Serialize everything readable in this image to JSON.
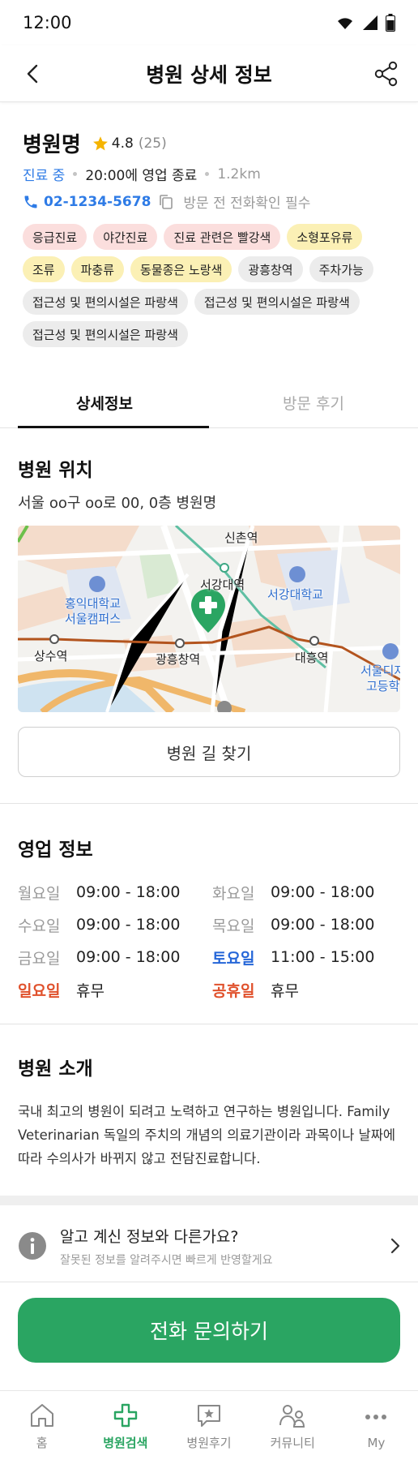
{
  "status_bar": {
    "time": "12:00"
  },
  "header": {
    "title": "병원 상세 정보"
  },
  "hospital": {
    "name": "병원명",
    "rating": "4.8",
    "review_count": "(25)",
    "open_status": "진료 중",
    "close_time": "20:00에 영업 종료",
    "distance": "1.2km",
    "phone": "02-1234-5678",
    "phone_note": "방문 전 전화확인 필수"
  },
  "tags": [
    {
      "label": "응급진료",
      "color": "red"
    },
    {
      "label": "야간진료",
      "color": "red"
    },
    {
      "label": "진료 관련은 빨강색",
      "color": "red"
    },
    {
      "label": "소형포유류",
      "color": "yellow"
    },
    {
      "label": "조류",
      "color": "yellow"
    },
    {
      "label": "파충류",
      "color": "yellow"
    },
    {
      "label": "동물종은 노랑색",
      "color": "yellow"
    },
    {
      "label": "광흥창역",
      "color": "gray"
    },
    {
      "label": "주차가능",
      "color": "gray"
    },
    {
      "label": "접근성 및 편의시설은 파랑색",
      "color": "gray"
    },
    {
      "label": "접근성 및 편의시설은 파랑색",
      "color": "gray"
    },
    {
      "label": "접근성 및 편의시설은 파랑색",
      "color": "gray"
    }
  ],
  "tabs": [
    {
      "label": "상세정보",
      "active": true
    },
    {
      "label": "방문 후기",
      "active": false
    }
  ],
  "location": {
    "title": "병원 위치",
    "address": "서울 oo구 oo로 00, 0층 병원명",
    "map_labels": {
      "sinchon": "신촌역",
      "seogang_station": "서강대역",
      "seogang_univ": "서강대학교",
      "hongik_1": "홍익대학교",
      "hongik_2": "서울캠퍼스",
      "sangsu": "상수역",
      "gwangheung": "광흥창역",
      "daeheung": "대흥역",
      "seoul_d_1": "서울디자",
      "seoul_d_2": "고등학"
    },
    "directions_button": "병원 길 찾기"
  },
  "business": {
    "title": "영업 정보",
    "hours": [
      [
        {
          "day": "월요일",
          "time": "09:00 - 18:00",
          "type": "normal"
        },
        {
          "day": "화요일",
          "time": "09:00 - 18:00",
          "type": "normal"
        }
      ],
      [
        {
          "day": "수요일",
          "time": "09:00 - 18:00",
          "type": "normal"
        },
        {
          "day": "목요일",
          "time": "09:00 - 18:00",
          "type": "normal"
        }
      ],
      [
        {
          "day": "금요일",
          "time": "09:00 - 18:00",
          "type": "normal"
        },
        {
          "day": "토요일",
          "time": "11:00 - 15:00",
          "type": "sat"
        }
      ],
      [
        {
          "day": "일요일",
          "time": "휴무",
          "type": "sun"
        },
        {
          "day": "공휴일",
          "time": "휴무",
          "type": "sun"
        }
      ]
    ]
  },
  "intro": {
    "title": "병원 소개",
    "text": "국내 최고의 병원이 되려고 노력하고 연구하는 병원입니다. Family Veterinarian 독일의 주치의 개념의 의료기관이라 과목이나 날짜에 따라 수의사가 바뀌지 않고 전담진료합니다."
  },
  "report": {
    "title": "알고 계신 정보와 다른가요?",
    "subtitle": "잘못된 정보를 알려주시면 빠르게 반영할게요"
  },
  "call_button": "전화 문의하기",
  "nav": [
    {
      "label": "홈",
      "icon": "home-icon",
      "active": false
    },
    {
      "label": "병원검색",
      "icon": "cross-icon",
      "active": true
    },
    {
      "label": "병원후기",
      "icon": "review-icon",
      "active": false
    },
    {
      "label": "커뮤니티",
      "icon": "community-icon",
      "active": false
    },
    {
      "label": "My",
      "icon": "more-icon",
      "active": false
    }
  ],
  "colors": {
    "brand_green": "#2aa562",
    "link_blue": "#2e7be6",
    "saturday_blue": "#2566d8",
    "holiday_red": "#e0512c",
    "tag_red": "#fbdedd",
    "tag_yellow": "#fbf0b5",
    "tag_gray": "#ececec"
  }
}
